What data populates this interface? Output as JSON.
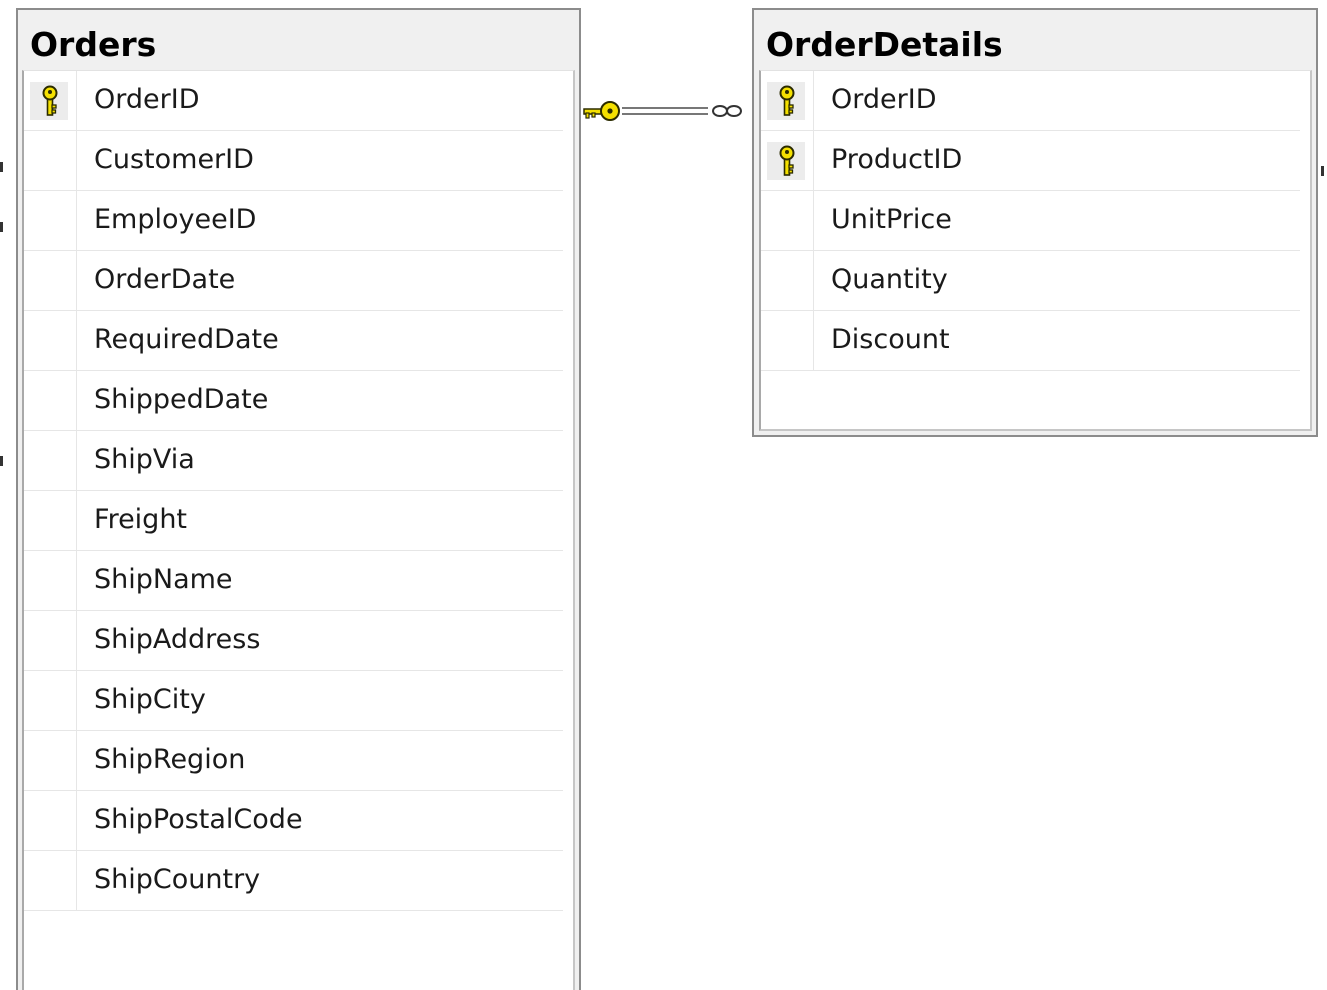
{
  "tables": {
    "orders": {
      "title": "Orders",
      "rows": [
        {
          "label": "OrderID",
          "key": true
        },
        {
          "label": "CustomerID",
          "key": false
        },
        {
          "label": "EmployeeID",
          "key": false
        },
        {
          "label": "OrderDate",
          "key": false
        },
        {
          "label": "RequiredDate",
          "key": false
        },
        {
          "label": "ShippedDate",
          "key": false
        },
        {
          "label": "ShipVia",
          "key": false
        },
        {
          "label": "Freight",
          "key": false
        },
        {
          "label": "ShipName",
          "key": false
        },
        {
          "label": "ShipAddress",
          "key": false
        },
        {
          "label": "ShipCity",
          "key": false
        },
        {
          "label": "ShipRegion",
          "key": false
        },
        {
          "label": "ShipPostalCode",
          "key": false
        },
        {
          "label": "ShipCountry",
          "key": false
        }
      ]
    },
    "order_details": {
      "title": "OrderDetails",
      "rows": [
        {
          "label": "OrderID",
          "key": true
        },
        {
          "label": "ProductID",
          "key": true
        },
        {
          "label": "UnitPrice",
          "key": false
        },
        {
          "label": "Quantity",
          "key": false
        },
        {
          "label": "Discount",
          "key": false
        }
      ]
    }
  },
  "relationship": {
    "from_table": "Orders",
    "to_table": "OrderDetails",
    "from_end": "key-icon",
    "to_end": "infinity-icon"
  },
  "colors": {
    "key_fill": "#f4e000",
    "key_outline": "#2b2b00",
    "connector": "#777777"
  }
}
